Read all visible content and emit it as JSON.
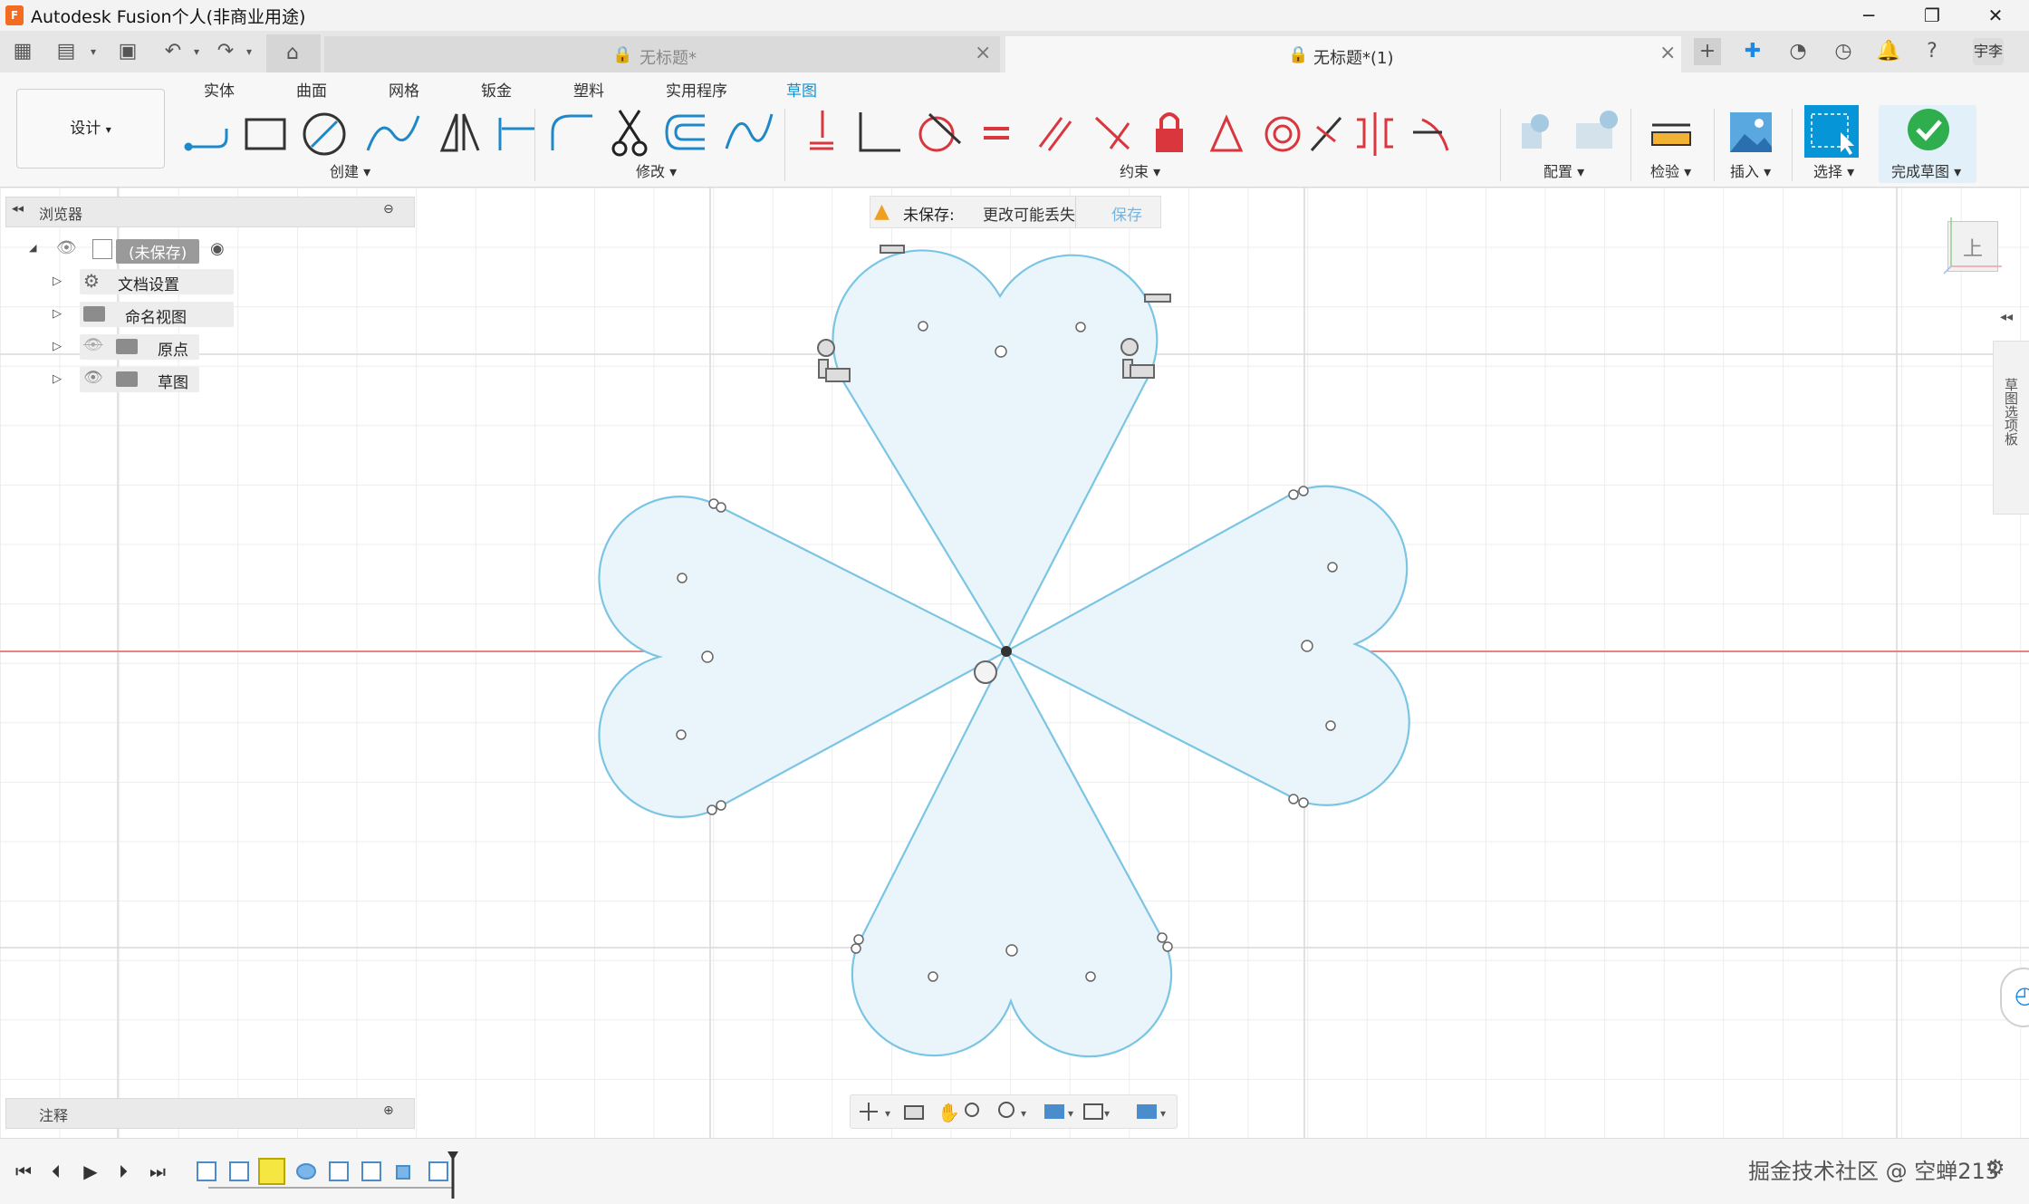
{
  "app": {
    "title": "Autodesk Fusion个人(非商业用途)",
    "logo_text": "F",
    "window_controls": [
      "─",
      "❐",
      "✕"
    ]
  },
  "tabs": [
    {
      "label": "无标题*",
      "active": false
    },
    {
      "label": "无标题*(1)",
      "active": true
    }
  ],
  "user": {
    "avatar_text": "宇李"
  },
  "ribbon": {
    "workspace": "设计",
    "workspace_tabs": [
      "实体",
      "曲面",
      "网格",
      "钣金",
      "塑料",
      "实用程序",
      "草图"
    ],
    "active_tab": "草图",
    "groups": {
      "create": "创建",
      "modify": "修改",
      "constraints": "约束",
      "configure": "配置",
      "inspect": "检验",
      "insert": "插入",
      "select": "选择",
      "finish": "完成草图"
    },
    "colors": {
      "accent": "#0696d7",
      "finish_green": "#2fae4e",
      "constraint_red": "#d9363e"
    }
  },
  "browser": {
    "header": "浏览器",
    "root": "(未保存)",
    "items": [
      {
        "label": "文档设置",
        "icon": "gear-icon"
      },
      {
        "label": "命名视图",
        "icon": "folder-icon"
      },
      {
        "label": "原点",
        "icon": "folder-icon"
      },
      {
        "label": "草图",
        "icon": "folder-icon"
      }
    ]
  },
  "banner": {
    "status": "未保存:",
    "message": "更改可能丢失",
    "action": "保存"
  },
  "notes": {
    "label": "注释"
  },
  "side_panel": {
    "label": "草图选项板"
  },
  "viewcube": {
    "face": "上"
  },
  "watermark": "掘金技术社区 @ 空蝉213"
}
